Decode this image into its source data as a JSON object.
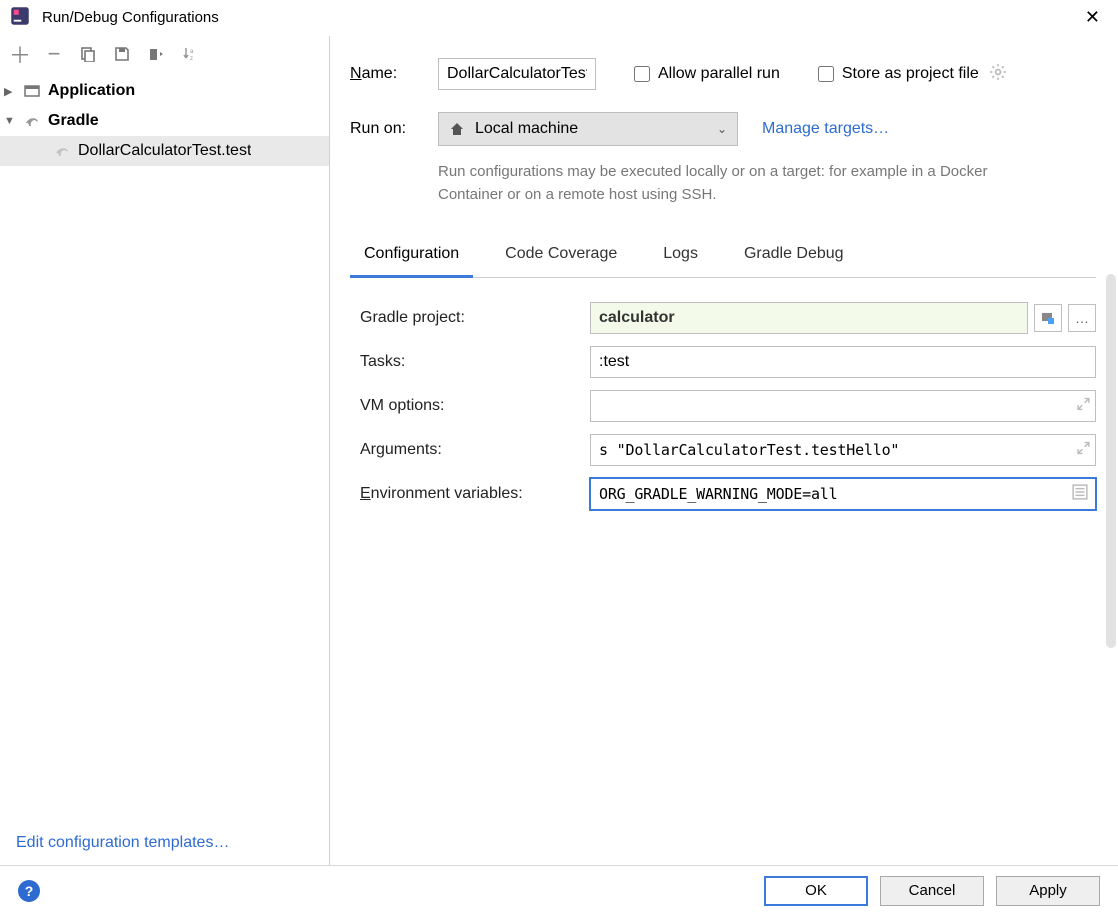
{
  "window": {
    "title": "Run/Debug Configurations",
    "close_glyph": "✕"
  },
  "toolbar": {
    "add": "+",
    "remove": "−",
    "copy": "copy",
    "save": "save",
    "edit": "edit",
    "sort": "sort"
  },
  "tree": {
    "application": {
      "chevron": "▶",
      "label": "Application"
    },
    "gradle": {
      "chevron": "▼",
      "label": "Gradle"
    },
    "child": {
      "label": "DollarCalculatorTest.test"
    }
  },
  "leftFooter": {
    "edit_templates": "Edit configuration templates…"
  },
  "form": {
    "name": {
      "label_pre": "N",
      "label_post": "ame:",
      "value": "DollarCalculatorTest.testHello"
    },
    "allow_parallel": "Allow parallel run",
    "store": {
      "u": "S",
      "rest": "tore as project file"
    },
    "run_on": {
      "label": "Run on:",
      "value": "Local machine",
      "manage": "Manage targets…",
      "chevron": "⌄"
    },
    "hint": "Run configurations may be executed locally or on a target: for example in a Docker Container or on a remote host using SSH."
  },
  "tabs": {
    "configuration": "Configuration",
    "coverage": "Code Coverage",
    "logs": "Logs",
    "gradle_debug": "Gradle Debug"
  },
  "fields": {
    "gradle_project": {
      "label": "Gradle project:",
      "value": "calculator",
      "ellipsis": "…"
    },
    "tasks": {
      "label": "Tasks:",
      "value": ":test"
    },
    "vm": {
      "label": "VM options:",
      "value": "",
      "expand": "↗"
    },
    "args": {
      "label": "Arguments:",
      "value": "s \"DollarCalculatorTest.testHello\"",
      "expand": "↗"
    },
    "env": {
      "label_u": "E",
      "label_rest": "nvironment variables:",
      "value": "ORG_GRADLE_WARNING_MODE=all"
    }
  },
  "footer": {
    "help": "?",
    "ok": "OK",
    "cancel": "Cancel",
    "apply": "Apply"
  }
}
